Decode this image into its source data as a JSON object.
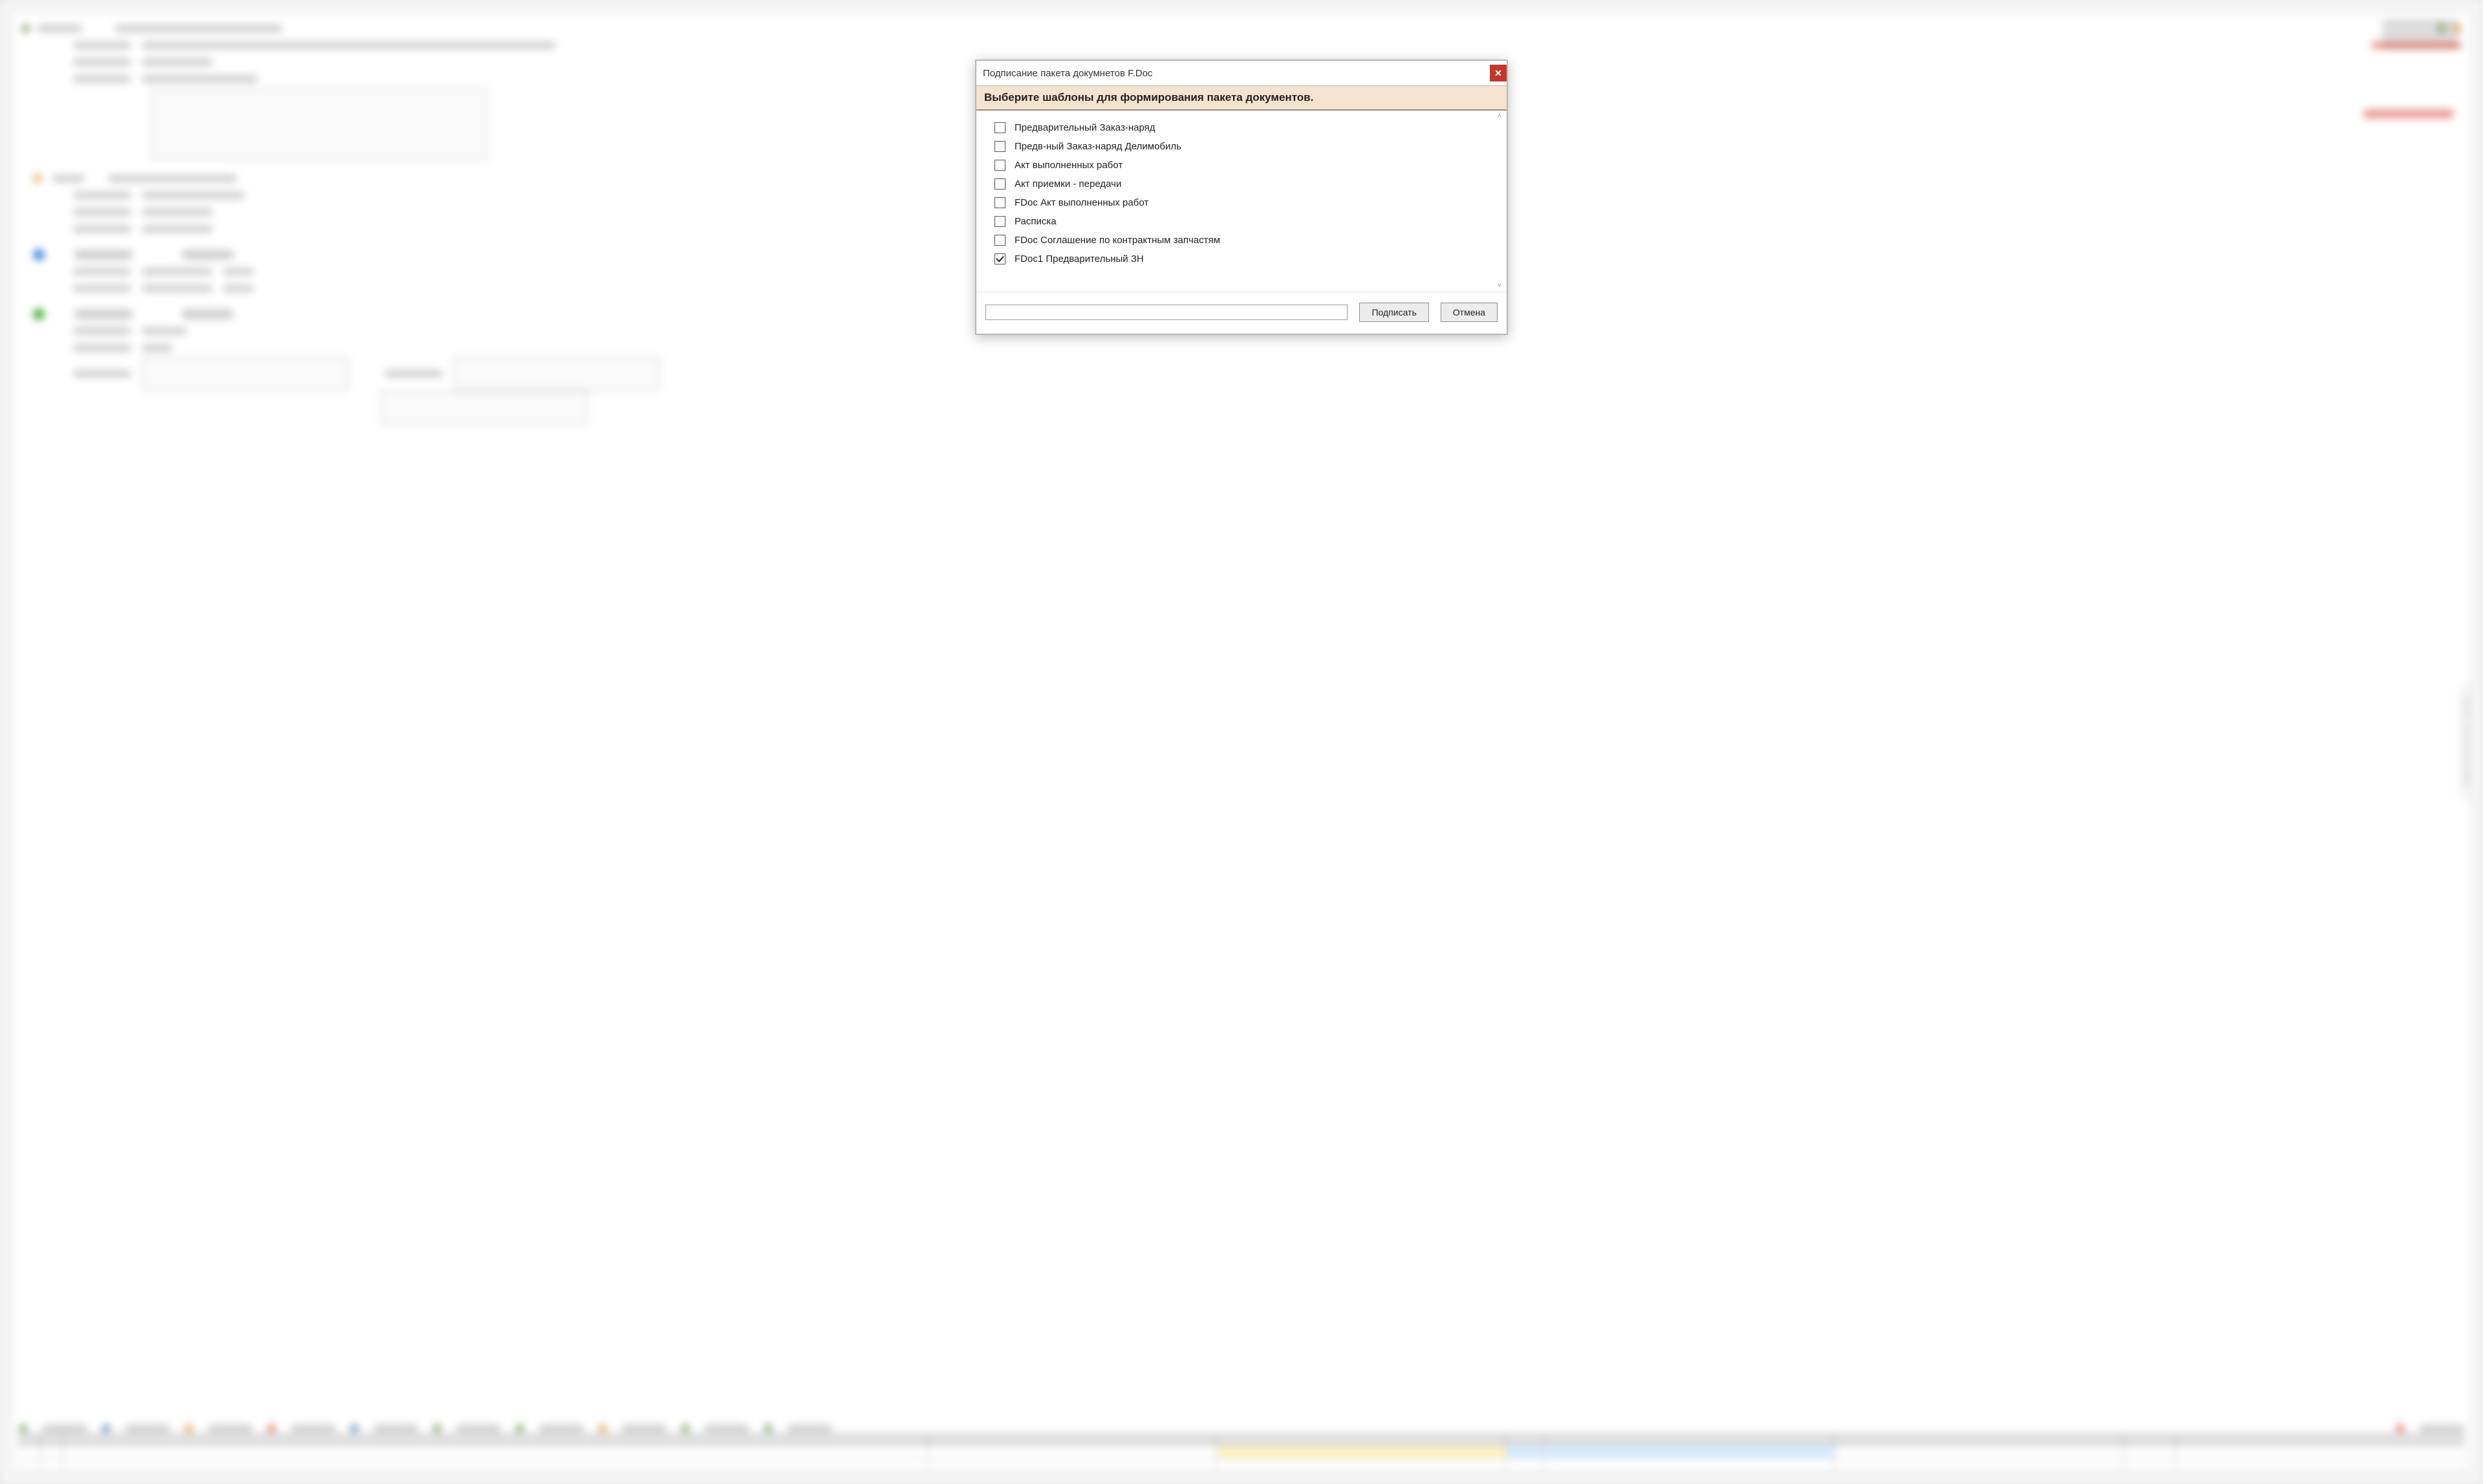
{
  "modal": {
    "title": "Подписание пакета докумнетов F.Doc",
    "banner": "Выберите шаблоны для формирования пакета документов.",
    "options": [
      {
        "label": "Предварительный Заказ-наряд",
        "checked": false
      },
      {
        "label": "Предв-ный Заказ-наряд Делимобиль",
        "checked": false
      },
      {
        "label": "Акт выполненных работ",
        "checked": false
      },
      {
        "label": "Акт приемки - передачи",
        "checked": false
      },
      {
        "label": "FDoc Акт выполненных работ",
        "checked": false
      },
      {
        "label": "Расписка",
        "checked": false
      },
      {
        "label": "FDoc  Соглашение по контрактным запчастям",
        "checked": false
      },
      {
        "label": "FDoc1 Предварительный ЗН",
        "checked": true
      }
    ],
    "input_value": "",
    "submit": "Подписать",
    "cancel": "Отмена",
    "close_glyph": "✕"
  }
}
